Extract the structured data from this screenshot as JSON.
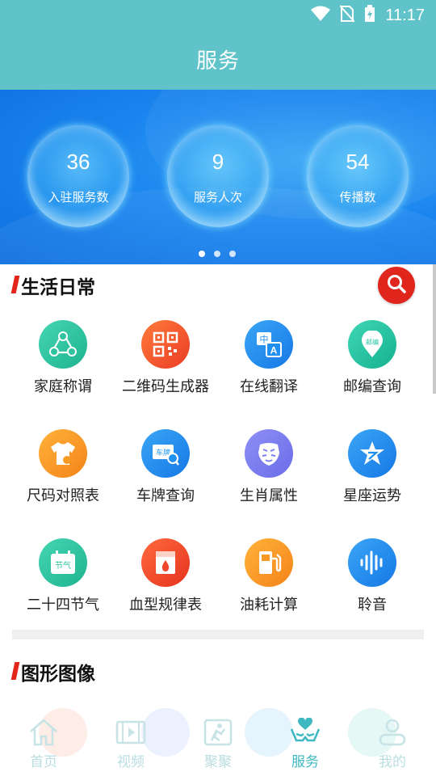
{
  "status_bar": {
    "time": "11:17",
    "icons": [
      "wifi-icon",
      "no-sim-icon",
      "battery-charging-icon"
    ]
  },
  "header": {
    "title": "服务"
  },
  "banner": {
    "stats": [
      {
        "value": "36",
        "label": "入驻服务数"
      },
      {
        "value": "9",
        "label": "服务人次"
      },
      {
        "value": "54",
        "label": "传播数"
      }
    ],
    "pager": {
      "count": 3,
      "active_index": 0
    }
  },
  "section_life": {
    "title": "生活日常",
    "items": [
      {
        "label": "家庭称谓",
        "icon": "family-icon",
        "color": "#2fc3a0"
      },
      {
        "label": "二维码生成器",
        "icon": "qr-code-icon",
        "color": "#f35a2c"
      },
      {
        "label": "在线翻译",
        "icon": "translate-icon",
        "color": "#1f8ff0"
      },
      {
        "label": "邮编查询",
        "icon": "postcode-icon",
        "color": "#26c4a4"
      },
      {
        "label": "尺码对照表",
        "icon": "shirt-icon",
        "color": "#f79a23"
      },
      {
        "label": "车牌查询",
        "icon": "license-plate-icon",
        "color": "#1f93ef"
      },
      {
        "label": "生肖属性",
        "icon": "tiger-icon",
        "color": "#7b7ef0"
      },
      {
        "label": "星座运势",
        "icon": "star-icon",
        "color": "#1f8ff0"
      },
      {
        "label": "二十四节气",
        "icon": "solar-term-calendar-icon",
        "color": "#2ec6a2"
      },
      {
        "label": "血型规律表",
        "icon": "blood-type-icon",
        "color": "#f2472b"
      },
      {
        "label": "油耗计算",
        "icon": "fuel-pump-icon",
        "color": "#f79a23"
      },
      {
        "label": "聆音",
        "icon": "sound-wave-icon",
        "color": "#1f8ff0"
      }
    ]
  },
  "section_graphics": {
    "title": "图形图像",
    "peek_colors": [
      "#f26b3a",
      "#5b8cf0",
      "#2aa3ee",
      "#32c4a8"
    ]
  },
  "tabs": [
    {
      "label": "首页",
      "icon": "home-icon",
      "active": false
    },
    {
      "label": "视频",
      "icon": "video-icon",
      "active": false
    },
    {
      "label": "聚聚",
      "icon": "gathering-icon",
      "active": false
    },
    {
      "label": "服务",
      "icon": "service-hands-heart-icon",
      "active": true
    },
    {
      "label": "我的",
      "icon": "user-icon",
      "active": false
    }
  ],
  "colors": {
    "primary": "#5fc3c9",
    "accent_red": "#e0261c",
    "tab_active": "#3fb8c2",
    "tab_inactive": "#b9dde0"
  }
}
